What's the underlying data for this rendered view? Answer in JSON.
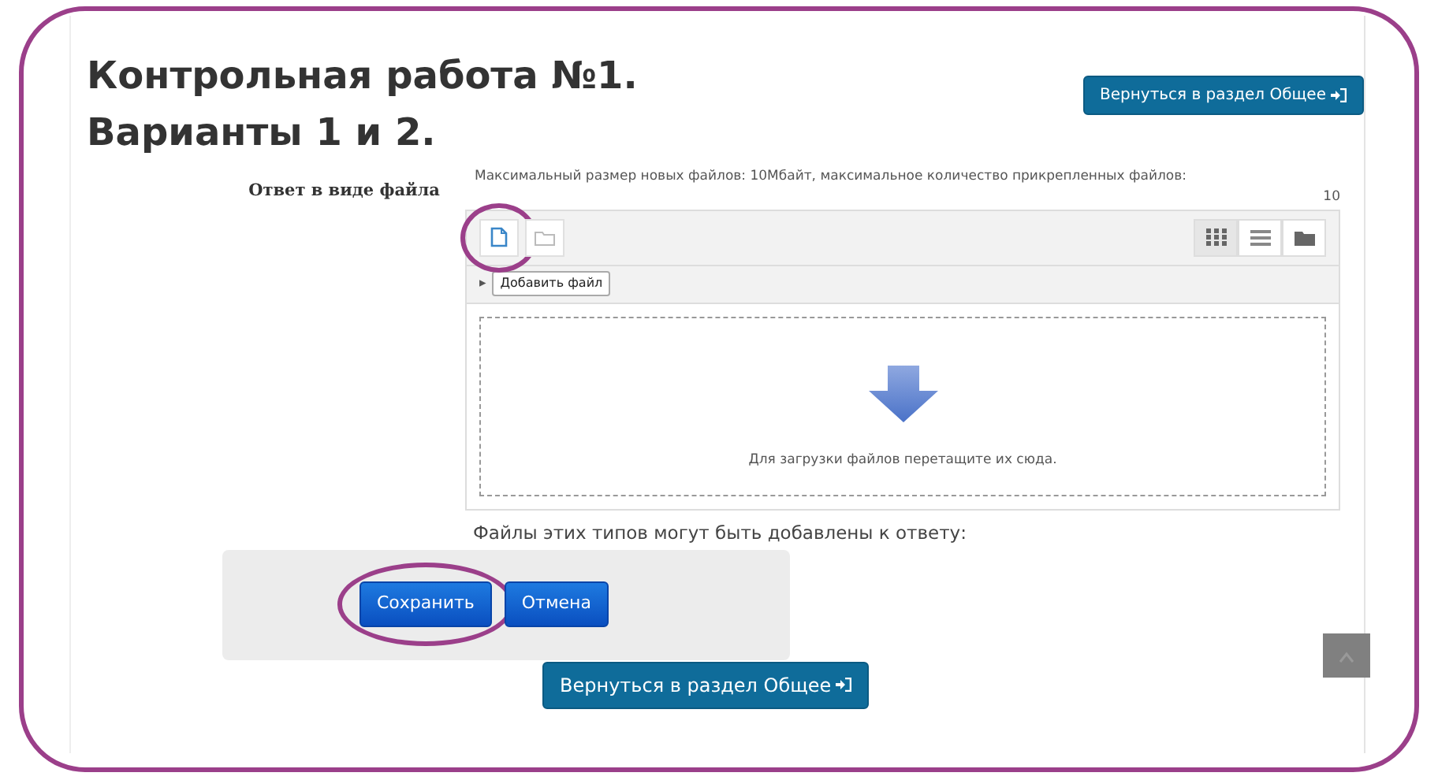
{
  "title": "Контрольная работа №1. Варианты 1 и 2.",
  "back_button_top": "Вернуться в раздел Общее",
  "field_label": "Ответ в виде файла",
  "limits_text": "Максимальный размер новых файлов: 10Мбайт, максимальное количество прикрепленных файлов:",
  "limits_count": "10",
  "file_tools": [
    {
      "kind": "file",
      "highlighted": true
    },
    {
      "kind": "folder",
      "highlighted": false
    }
  ],
  "view_buttons": [
    {
      "kind": "icons",
      "selected": true
    },
    {
      "kind": "list",
      "selected": false
    },
    {
      "kind": "tree",
      "selected": false
    }
  ],
  "path_toggle": "▸",
  "add_file_button": "Добавить файл",
  "dropzone_text": "Для загрузки файлов перетащите их сюда.",
  "file_types_text": "Файлы этих типов могут быть добавлены к ответу:",
  "form_buttons": [
    {
      "label": "Сохранить",
      "highlighted": true
    },
    {
      "label": "Отмена",
      "highlighted": false
    }
  ],
  "back_button_bottom": "Вернуться в раздел Общее"
}
